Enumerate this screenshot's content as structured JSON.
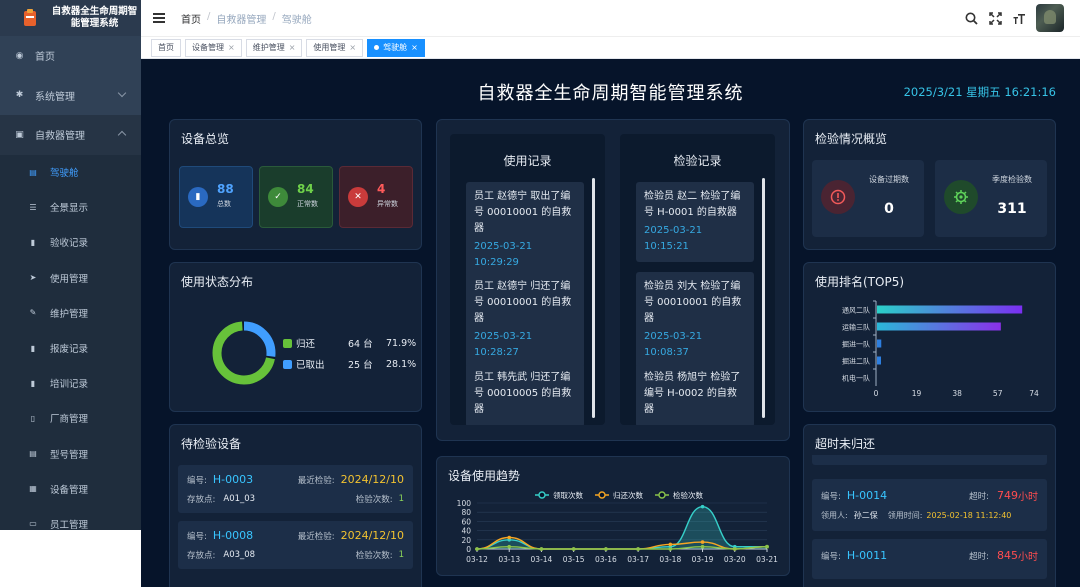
{
  "sidebar": {
    "logo_title": "自救器全生命周期智能管理系统",
    "home": "首页",
    "system": "系统管理",
    "rescuer": "自救器管理",
    "sub_items": [
      "驾驶舱",
      "全景显示",
      "验收记录",
      "使用管理",
      "维护管理",
      "报废记录",
      "培训记录",
      "厂商管理",
      "型号管理",
      "设备管理",
      "员工管理"
    ]
  },
  "breadcrumb": [
    "首页",
    "自救器管理",
    "驾驶舱"
  ],
  "tags": [
    "首页",
    "设备管理",
    "维护管理",
    "使用管理",
    "驾驶舱"
  ],
  "dashboard": {
    "title": "自救器全生命周期智能管理系统",
    "datetime": "2025/3/21 星期五 16:21:16",
    "overview": {
      "title": "设备总览",
      "stats": [
        {
          "value": "88",
          "label": "总数",
          "color": "#3a8ee6"
        },
        {
          "value": "84",
          "label": "正常数",
          "color": "#67c23a"
        },
        {
          "value": "4",
          "label": "异常数",
          "color": "#f56c6c"
        }
      ]
    },
    "usage_status": {
      "title": "使用状态分布",
      "items": [
        {
          "name": "归还",
          "count": "64 台",
          "pct": "71.9%",
          "value": 71.9,
          "color": "#67c23a"
        },
        {
          "name": "已取出",
          "count": "25 台",
          "pct": "28.1%",
          "value": 28.1,
          "color": "#409eff"
        }
      ]
    },
    "pending": {
      "title": "待检验设备",
      "code_label": "编号:",
      "last_label": "最近检验:",
      "loc_label": "存放点:",
      "count_label": "检验次数:",
      "items": [
        {
          "code": "H-0003",
          "date": "2024/12/10",
          "loc": "A01_03",
          "count": "1"
        },
        {
          "code": "H-0008",
          "date": "2024/12/10",
          "loc": "A03_08",
          "count": "1"
        }
      ]
    },
    "usage_records": {
      "title": "使用记录",
      "items": [
        {
          "text": "员工 赵德宁 取出了编号 00010001 的自救器",
          "time": "2025-03-21 10:29:29"
        },
        {
          "text": "员工 赵德宁 归还了编号 00010001 的自救器",
          "time": "2025-03-21 10:28:27"
        },
        {
          "text": "员工 韩先武 归还了编号 00010005 的自救器",
          "time": ""
        }
      ]
    },
    "inspect_records": {
      "title": "检验记录",
      "items": [
        {
          "text": "检验员 赵二 检验了编号 H-0001 的自救器",
          "time": "2025-03-21 10:15:21"
        },
        {
          "text": "检验员 刘大 检验了编号 00010001 的自救器",
          "time": "2025-03-21 10:08:37"
        },
        {
          "text": "检验员 杨旭宁 检验了编号 H-0002 的自救器",
          "time": ""
        }
      ]
    },
    "inspection": {
      "title": "检验情况概览",
      "expired_label": "设备过期数",
      "expired": "0",
      "quarter_label": "季度检验数",
      "quarter": "311"
    },
    "ranking_title": "使用排名(TOP5)",
    "overdue": {
      "title": "超时未归还",
      "code_label": "编号:",
      "over_label": "超时:",
      "user_label": "领用人:",
      "time_label": "领用时间:",
      "unit": "小时",
      "items": [
        {
          "code": "H-0014",
          "hours": "749",
          "user": "孙二保",
          "time": "2025-02-18 11:12:40"
        },
        {
          "code": "H-0011",
          "hours": "845",
          "user": "",
          "time": ""
        }
      ]
    },
    "trend_title": "设备使用趋势"
  },
  "chart_data": [
    {
      "type": "bar",
      "orientation": "horizontal",
      "title": "使用排名(TOP5)",
      "categories": [
        "通风二队",
        "运输三队",
        "掘进一队",
        "掘进二队",
        "机电一队"
      ],
      "values": [
        68,
        58,
        2,
        1,
        0
      ],
      "xlim": [
        0,
        74
      ],
      "xticks": [
        "0",
        "19",
        "38",
        "57",
        "74"
      ]
    },
    {
      "type": "line",
      "title": "设备使用趋势",
      "categories": [
        "03-12",
        "03-13",
        "03-14",
        "03-15",
        "03-16",
        "03-17",
        "03-18",
        "03-19",
        "03-20",
        "03-21"
      ],
      "ylim": [
        0,
        100
      ],
      "yticks": [
        "0",
        "20",
        "40",
        "60",
        "80",
        "100"
      ],
      "series": [
        {
          "name": "领取次数",
          "color": "#36cfc9",
          "values": [
            0,
            20,
            0,
            0,
            0,
            0,
            5,
            92,
            5,
            5
          ]
        },
        {
          "name": "归还次数",
          "color": "#f5a623",
          "values": [
            0,
            25,
            0,
            0,
            0,
            0,
            10,
            15,
            0,
            5
          ]
        },
        {
          "name": "检验次数",
          "color": "#8bc34a",
          "values": [
            0,
            5,
            0,
            0,
            0,
            0,
            0,
            5,
            0,
            5
          ]
        }
      ]
    }
  ]
}
